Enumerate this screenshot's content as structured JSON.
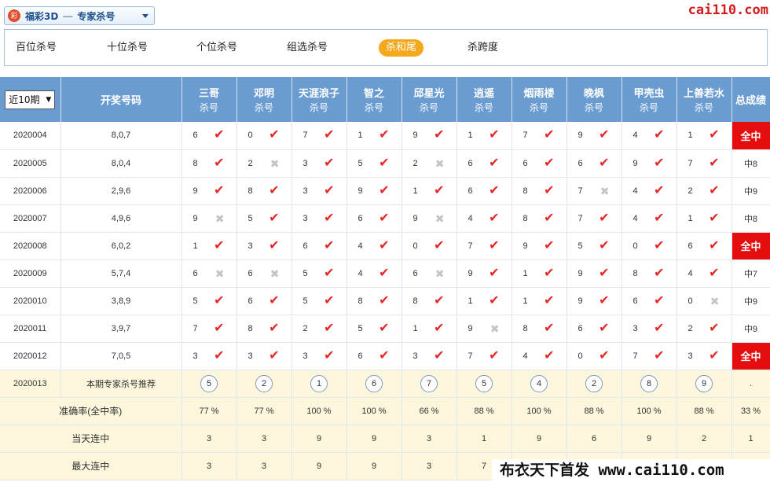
{
  "header": {
    "lottery_logo": "彩",
    "lottery_name": "福彩3D",
    "dash": "—",
    "lottery_sub": "专家杀号",
    "site_logo": "cai110.com"
  },
  "tabs": [
    {
      "label": "百位杀号",
      "active": false
    },
    {
      "label": "十位杀号",
      "active": false
    },
    {
      "label": "个位杀号",
      "active": false
    },
    {
      "label": "组选杀号",
      "active": false
    },
    {
      "label": "杀和尾",
      "active": true
    },
    {
      "label": "杀跨度",
      "active": false
    }
  ],
  "table": {
    "period_select": "近10期",
    "draw_col": "开奖号码",
    "experts": [
      {
        "name": "三哥",
        "sub": "杀号"
      },
      {
        "name": "邓明",
        "sub": "杀号"
      },
      {
        "name": "天涯浪子",
        "sub": "杀号"
      },
      {
        "name": "智之",
        "sub": "杀号"
      },
      {
        "name": "邱星光",
        "sub": "杀号"
      },
      {
        "name": "逍遥",
        "sub": "杀号"
      },
      {
        "name": "烟雨楼",
        "sub": "杀号"
      },
      {
        "name": "晚枫",
        "sub": "杀号"
      },
      {
        "name": "甲壳虫",
        "sub": "杀号"
      },
      {
        "name": "上善若水",
        "sub": "杀号"
      }
    ],
    "result_col": "总成绩",
    "rows": [
      {
        "period": "2020004",
        "draw": "8,0,7",
        "kills": [
          [
            "6",
            1
          ],
          [
            "0",
            1
          ],
          [
            "7",
            1
          ],
          [
            "1",
            1
          ],
          [
            "9",
            1
          ],
          [
            "1",
            1
          ],
          [
            "7",
            1
          ],
          [
            "9",
            1
          ],
          [
            "4",
            1
          ],
          [
            "1",
            1
          ]
        ],
        "result": "全中"
      },
      {
        "period": "2020005",
        "draw": "8,0,4",
        "kills": [
          [
            "8",
            1
          ],
          [
            "2",
            0
          ],
          [
            "3",
            1
          ],
          [
            "5",
            1
          ],
          [
            "2",
            0
          ],
          [
            "6",
            1
          ],
          [
            "6",
            1
          ],
          [
            "6",
            1
          ],
          [
            "9",
            1
          ],
          [
            "7",
            1
          ]
        ],
        "result": "中8"
      },
      {
        "period": "2020006",
        "draw": "2,9,6",
        "kills": [
          [
            "9",
            1
          ],
          [
            "8",
            1
          ],
          [
            "3",
            1
          ],
          [
            "9",
            1
          ],
          [
            "1",
            1
          ],
          [
            "6",
            1
          ],
          [
            "8",
            1
          ],
          [
            "7",
            0
          ],
          [
            "4",
            1
          ],
          [
            "2",
            1
          ]
        ],
        "result": "中9"
      },
      {
        "period": "2020007",
        "draw": "4,9,6",
        "kills": [
          [
            "9",
            0
          ],
          [
            "5",
            1
          ],
          [
            "3",
            1
          ],
          [
            "6",
            1
          ],
          [
            "9",
            0
          ],
          [
            "4",
            1
          ],
          [
            "8",
            1
          ],
          [
            "7",
            1
          ],
          [
            "4",
            1
          ],
          [
            "1",
            1
          ]
        ],
        "result": "中8"
      },
      {
        "period": "2020008",
        "draw": "6,0,2",
        "kills": [
          [
            "1",
            1
          ],
          [
            "3",
            1
          ],
          [
            "6",
            1
          ],
          [
            "4",
            1
          ],
          [
            "0",
            1
          ],
          [
            "7",
            1
          ],
          [
            "9",
            1
          ],
          [
            "5",
            1
          ],
          [
            "0",
            1
          ],
          [
            "6",
            1
          ]
        ],
        "result": "全中"
      },
      {
        "period": "2020009",
        "draw": "5,7,4",
        "kills": [
          [
            "6",
            0
          ],
          [
            "6",
            0
          ],
          [
            "5",
            1
          ],
          [
            "4",
            1
          ],
          [
            "6",
            0
          ],
          [
            "9",
            1
          ],
          [
            "1",
            1
          ],
          [
            "9",
            1
          ],
          [
            "8",
            1
          ],
          [
            "4",
            1
          ]
        ],
        "result": "中7"
      },
      {
        "period": "2020010",
        "draw": "3,8,9",
        "kills": [
          [
            "5",
            1
          ],
          [
            "6",
            1
          ],
          [
            "5",
            1
          ],
          [
            "8",
            1
          ],
          [
            "8",
            1
          ],
          [
            "1",
            1
          ],
          [
            "1",
            1
          ],
          [
            "9",
            1
          ],
          [
            "6",
            1
          ],
          [
            "0",
            0
          ]
        ],
        "result": "中9"
      },
      {
        "period": "2020011",
        "draw": "3,9,7",
        "kills": [
          [
            "7",
            1
          ],
          [
            "8",
            1
          ],
          [
            "2",
            1
          ],
          [
            "5",
            1
          ],
          [
            "1",
            1
          ],
          [
            "9",
            0
          ],
          [
            "8",
            1
          ],
          [
            "6",
            1
          ],
          [
            "3",
            1
          ],
          [
            "2",
            1
          ]
        ],
        "result": "中9"
      },
      {
        "period": "2020012",
        "draw": "7,0,5",
        "kills": [
          [
            "3",
            1
          ],
          [
            "3",
            1
          ],
          [
            "3",
            1
          ],
          [
            "6",
            1
          ],
          [
            "3",
            1
          ],
          [
            "7",
            1
          ],
          [
            "4",
            1
          ],
          [
            "0",
            1
          ],
          [
            "7",
            1
          ],
          [
            "3",
            1
          ]
        ],
        "result": "全中"
      }
    ],
    "recommend": {
      "period": "2020013",
      "label": "本期专家杀号推荐",
      "values": [
        "5",
        "2",
        "1",
        "6",
        "7",
        "5",
        "4",
        "2",
        "8",
        "9"
      ],
      "result": "."
    },
    "accuracy": {
      "label": "准确率(全中率)",
      "values": [
        "77 %",
        "77 %",
        "100 %",
        "100 %",
        "66 %",
        "88 %",
        "100 %",
        "88 %",
        "100 %",
        "88 %"
      ],
      "result": "33 %"
    },
    "current_streak": {
      "label": "当天连中",
      "values": [
        "3",
        "3",
        "9",
        "9",
        "3",
        "1",
        "9",
        "6",
        "9",
        "2"
      ],
      "result": "1"
    },
    "max_streak": {
      "label": "最大连中",
      "values": [
        "3",
        "3",
        "9",
        "9",
        "3",
        "7",
        "",
        "",
        "",
        ""
      ],
      "result": ""
    }
  },
  "watermark": "布衣天下首发 www.cai110.com"
}
